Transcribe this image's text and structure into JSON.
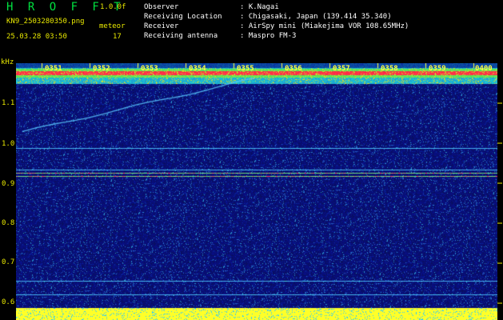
{
  "header": {
    "app_title": "H R O F F T",
    "version": "1.0.0f",
    "filename": "KN9_2503280350.png",
    "meteor_label": "meteor",
    "meteor_count": "17",
    "timestamp": "25.03.28 03:50"
  },
  "info": [
    {
      "key": "Observer",
      "value": ": K.Nagai"
    },
    {
      "key": "Receiving Location",
      "value": ": Chigasaki, Japan (139.414 35.340)"
    },
    {
      "key": "Receiver",
      "value": ": AirSpy mini (Miakejima VOR 108.65MHz)"
    },
    {
      "key": "Receiving antenna",
      "value": ": Maspro FM-3"
    }
  ],
  "axis": {
    "unit": "kHz",
    "y_labels": [
      "1.1",
      "1.0",
      "0.9",
      "0.8",
      "0.7",
      "0.6"
    ],
    "time_labels": [
      "0351",
      "0352",
      "0353",
      "0354",
      "0355",
      "0356",
      "0357",
      "0358",
      "0359",
      "0400"
    ]
  },
  "colors": {
    "text_yellow": "#e8e800",
    "title_green": "#00e040",
    "background_blue": "#0a1070",
    "band_red": "#ff2040",
    "band_green": "#30ff60",
    "floor_yellow": "#ffff30",
    "cyan_line": "#40c0ff"
  }
}
